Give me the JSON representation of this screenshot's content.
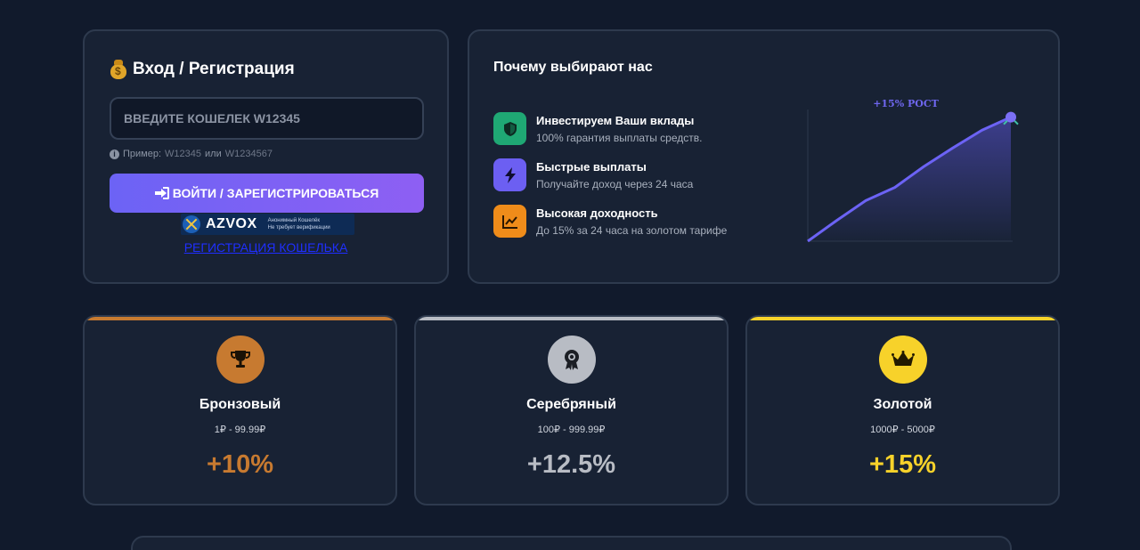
{
  "login": {
    "title": "Вход / Регистрация",
    "input_placeholder": "ВВЕДИТЕ КОШЕЛЕК W12345",
    "hint_prefix": "Пример:",
    "hint_example1": "W12345",
    "hint_or": "или",
    "hint_example2": "W1234567",
    "button_label": "ВОЙТИ / ЗАРЕГИСТРИРОВАТЬСЯ",
    "banner_brand": "AZVOX",
    "banner_line1": "Анонимный Кошелёк",
    "banner_line2": "Не требует верификации",
    "register_link": "РЕГИСТРАЦИЯ КОШЕЛЬКА"
  },
  "why": {
    "title": "Почему выбирают нас",
    "features": [
      {
        "title": "Инвестируем Ваши вклады",
        "desc": "100% гарантия выплаты средств.",
        "icon": "shield-icon",
        "color": "#1fa874"
      },
      {
        "title": "Быстрые выплаты",
        "desc": "Получайте доход через 24 часа",
        "icon": "lightning-icon",
        "color": "#6c5ff2"
      },
      {
        "title": "Высокая доходность",
        "desc": "До 15% за 24 часа на золотом тарифе",
        "icon": "chart-line-icon",
        "color": "#ef8c1a"
      }
    ],
    "chart_label": "+15% РОСТ"
  },
  "chart_data": {
    "type": "area",
    "title": "+15% РОСТ",
    "x": [
      0,
      1,
      2,
      3,
      4,
      5,
      6,
      7
    ],
    "values": [
      0,
      19,
      37,
      49,
      68,
      85,
      101,
      113
    ],
    "ylim": [
      0,
      120
    ],
    "color": "#6c63f5"
  },
  "tariffs": [
    {
      "name": "Бронзовый",
      "range": "1₽ - 99.99₽",
      "rate": "+10%",
      "color": "#c77a30",
      "icon": "trophy-icon"
    },
    {
      "name": "Серебряный",
      "range": "100₽ - 999.99₽",
      "rate": "+12.5%",
      "color": "#b8bcc4",
      "icon": "medal-icon"
    },
    {
      "name": "Золотой",
      "range": "1000₽ - 5000₽",
      "rate": "+15%",
      "color": "#f7d22a",
      "icon": "crown-icon"
    }
  ]
}
